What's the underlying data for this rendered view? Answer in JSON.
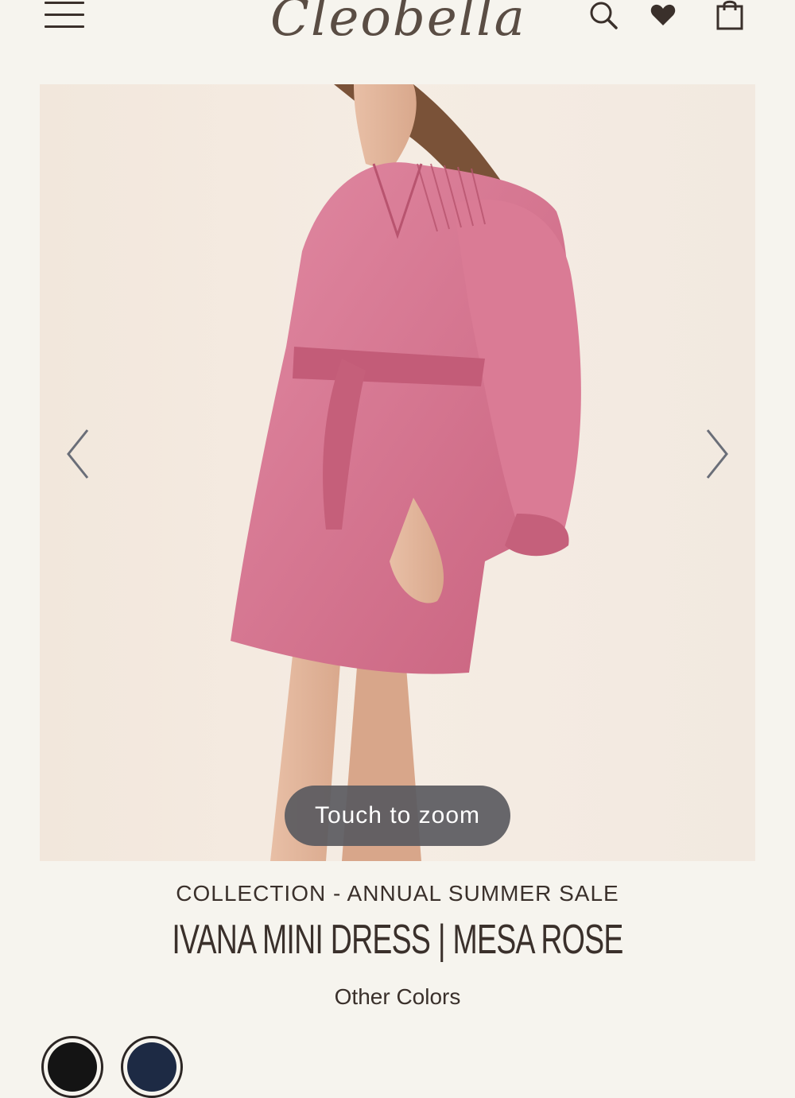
{
  "header": {
    "logo_text": "Cleobella",
    "icons": [
      "menu-icon",
      "search-icon",
      "heart-icon",
      "shopping-bag-icon"
    ]
  },
  "gallery": {
    "zoom_hint": "Touch to zoom",
    "prev_icon": "chevron-left-icon",
    "next_icon": "chevron-right-icon"
  },
  "product": {
    "collection": "COLLECTION - ANNUAL SUMMER SALE",
    "title": "IVANA MINI DRESS | MESA ROSE",
    "other_colors_label": "Other Colors"
  },
  "swatches": [
    {
      "name": "black",
      "color": "#141414"
    },
    {
      "name": "navy",
      "color": "#1d2a44"
    }
  ],
  "colors": {
    "background": "#f6f4ee",
    "text": "#3a302b",
    "dress": "#d9748f"
  }
}
